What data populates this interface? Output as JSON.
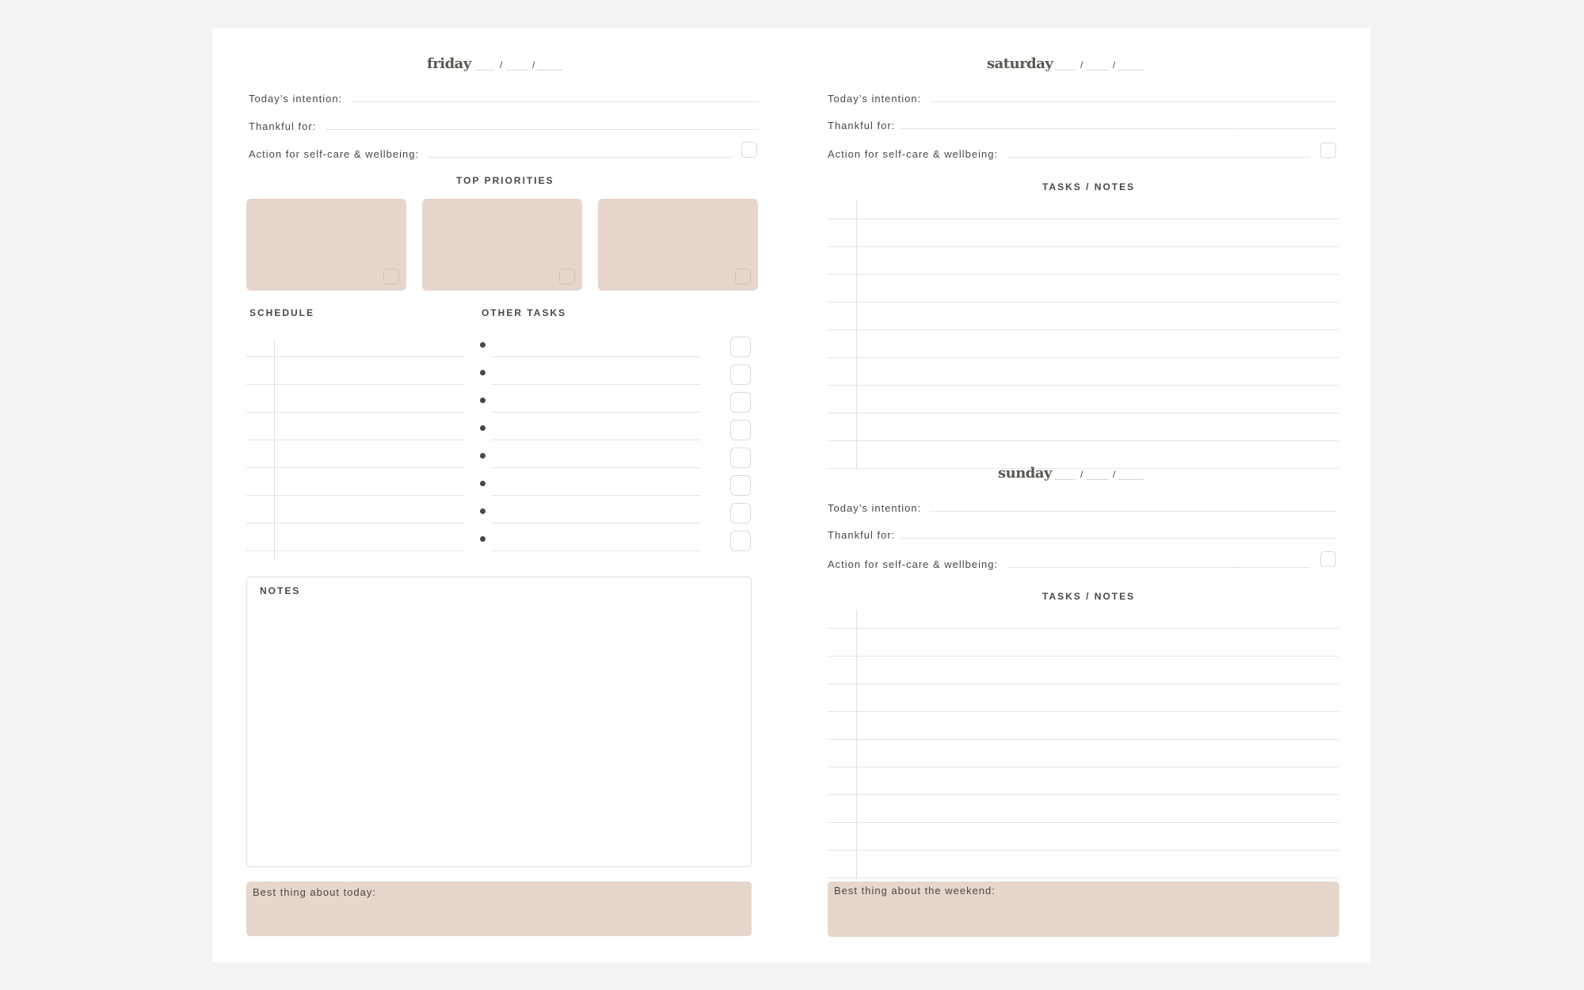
{
  "friday": {
    "day": "friday",
    "date_sep": "/",
    "intention_label": "Today’s intention:",
    "thankful_label": "Thankful for:",
    "selfcare_label": "Action for self-care & wellbeing:",
    "top_priorities_heading": "TOP PRIORITIES",
    "schedule_heading": "SCHEDULE",
    "other_tasks_heading": "OTHER TASKS",
    "notes_heading": "NOTES",
    "best_label": "Best thing about today:"
  },
  "saturday": {
    "day": "saturday",
    "date_sep": "/",
    "intention_label": "Today’s intention:",
    "thankful_label": "Thankful for:",
    "selfcare_label": "Action for self-care & wellbeing:",
    "tasks_heading": "TASKS / NOTES"
  },
  "sunday": {
    "day": "sunday",
    "date_sep": "/",
    "intention_label": "Today’s intention:",
    "thankful_label": "Thankful for:",
    "selfcare_label": "Action for self-care & wellbeing:",
    "tasks_heading": "TASKS / NOTES",
    "best_label": "Best thing about the weekend:"
  },
  "colors": {
    "accent_box": "#e6d6cc",
    "text": "#4a4845",
    "page": "#ffffff",
    "background": "#f4f3f1"
  }
}
